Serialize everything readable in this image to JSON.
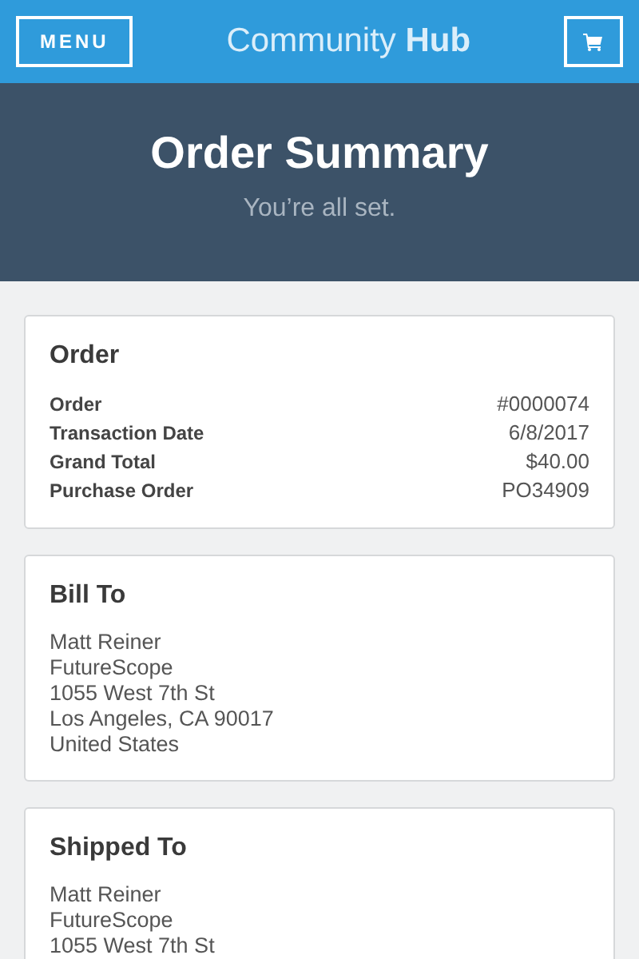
{
  "header": {
    "menu_label": "MENU",
    "logo": "Community **Hub**"
  },
  "hero": {
    "title": "Order Summary",
    "subtitle": "You’re all set."
  },
  "order": {
    "title": "Order",
    "rows": [
      {
        "label": "Order",
        "value": "#0000074"
      },
      {
        "label": "Transaction Date",
        "value": "6/8/2017"
      },
      {
        "label": "Grand Total",
        "value": "$40.00"
      },
      {
        "label": "Purchase Order",
        "value": "PO34909"
      }
    ]
  },
  "addresses": [
    {
      "title": "Bill To",
      "lines": [
        "Matt Reiner",
        "FutureScope",
        "1055 West 7th St",
        "Los Angeles, CA 90017",
        "United States"
      ]
    },
    {
      "title": "Shipped To",
      "lines": [
        "Matt Reiner",
        "FutureScope",
        "1055 West 7th St"
      ]
    }
  ]
}
